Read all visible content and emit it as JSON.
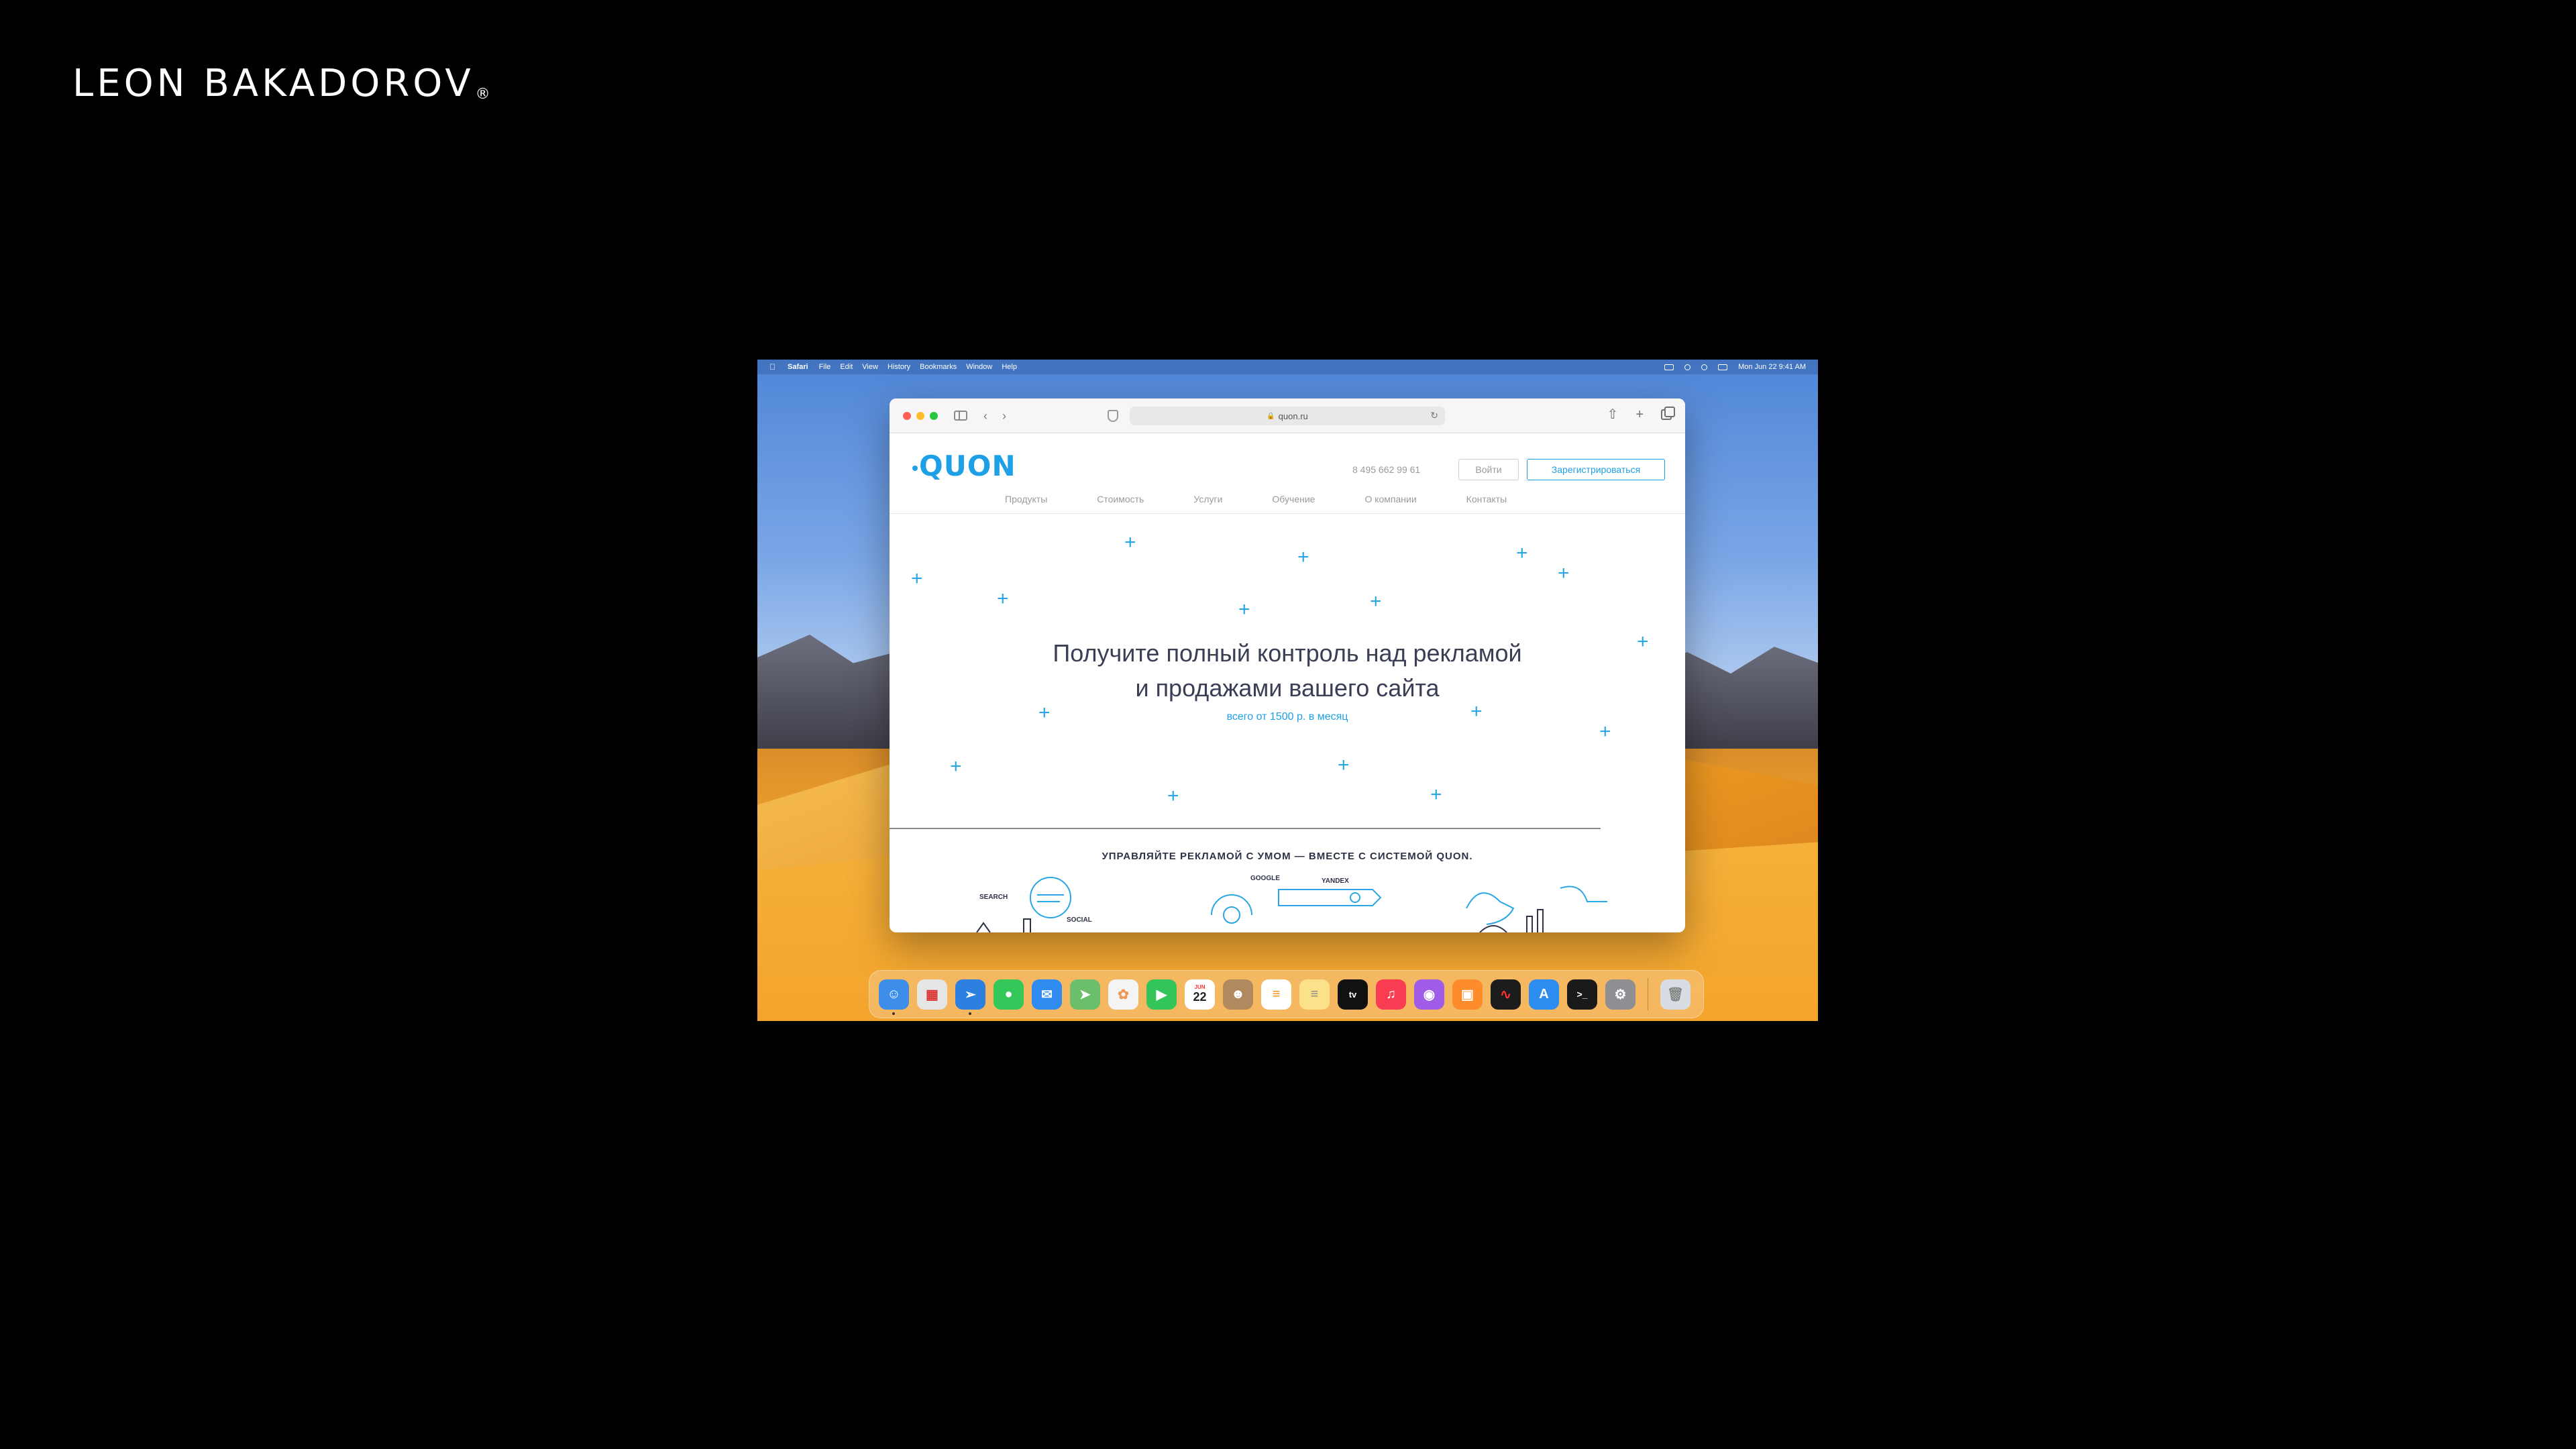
{
  "brand": {
    "name": "LEON BAKADOROV",
    "mark": "®"
  },
  "menubar": {
    "app": "Safari",
    "items": [
      "File",
      "Edit",
      "View",
      "History",
      "Bookmarks",
      "Window",
      "Help"
    ],
    "datetime": "Mon Jun 22  9:41 AM"
  },
  "browser": {
    "url": "quon.ru"
  },
  "site": {
    "logo": "QUON",
    "phone": "8 495 662 99 61",
    "login_label": "Войти",
    "register_label": "Зарегистрироваться",
    "nav": [
      "Продукты",
      "Стоимость",
      "Услуги",
      "Обучение",
      "О компании",
      "Контакты"
    ],
    "hero_title_line1": "Получите полный контроль над рекламой",
    "hero_title_line2": "и продажами вашего сайта",
    "hero_subtitle": "всего от 1500 р. в месяц",
    "section_title": "УПРАВЛЯЙТЕ РЕКЛАМОЙ С УМОМ — ВМЕСТЕ С СИСТЕМОЙ QUON.",
    "illus_labels": [
      "SEARCH",
      "SOCIAL",
      "GOOGLE",
      "YANDEX"
    ]
  },
  "dock": {
    "calendar_day": "22",
    "calendar_month": "JUN",
    "apps": [
      {
        "name": "finder",
        "color": "#3d8ee8"
      },
      {
        "name": "launchpad",
        "color": "#e6e6e6"
      },
      {
        "name": "safari",
        "color": "#2d7fe0"
      },
      {
        "name": "messages",
        "color": "#34c759"
      },
      {
        "name": "mail",
        "color": "#2f8bf0"
      },
      {
        "name": "maps",
        "color": "#6bbf6a"
      },
      {
        "name": "photos",
        "color": "#f4f4f4"
      },
      {
        "name": "facetime",
        "color": "#33c55a"
      },
      {
        "name": "calendar",
        "color": "#ffffff"
      },
      {
        "name": "contacts",
        "color": "#b08a5e"
      },
      {
        "name": "reminders",
        "color": "#ffffff"
      },
      {
        "name": "notes",
        "color": "#fbe28a"
      },
      {
        "name": "apple-tv",
        "color": "#111111"
      },
      {
        "name": "music",
        "color": "#fa3c52"
      },
      {
        "name": "podcasts",
        "color": "#a05ce6"
      },
      {
        "name": "books",
        "color": "#ff8c2a"
      },
      {
        "name": "voice-memos",
        "color": "#1c1c1c"
      },
      {
        "name": "app-store",
        "color": "#2d8cf0"
      },
      {
        "name": "terminal",
        "color": "#1a1a1a"
      },
      {
        "name": "system-preferences",
        "color": "#8e8e93"
      },
      {
        "name": "trash",
        "color": "#d8dde3"
      }
    ]
  }
}
